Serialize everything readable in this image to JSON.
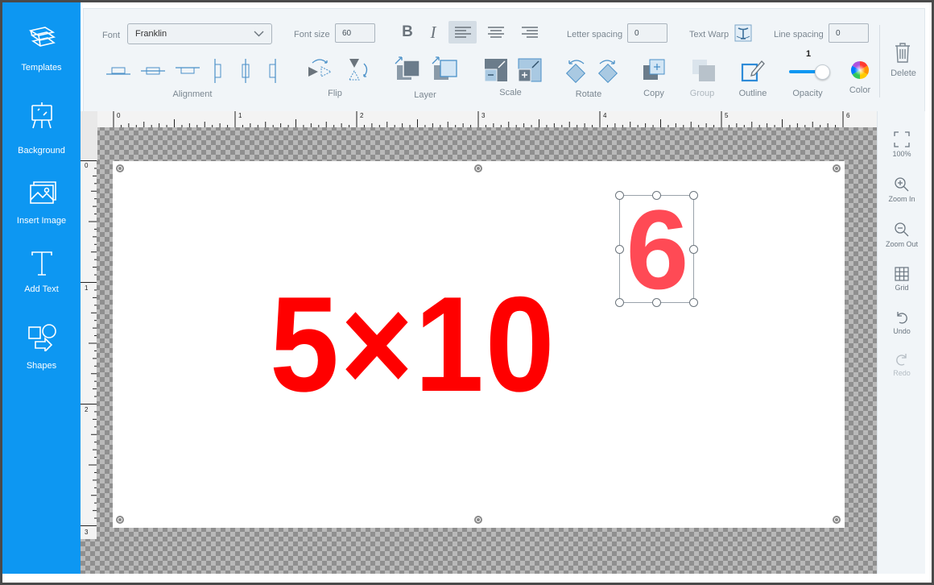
{
  "sidebar": {
    "items": [
      {
        "label": "Templates",
        "icon": "templates-icon"
      },
      {
        "label": "Background",
        "icon": "background-icon"
      },
      {
        "label": "Insert Image",
        "icon": "insert-image-icon"
      },
      {
        "label": "Add Text",
        "icon": "add-text-icon"
      },
      {
        "label": "Shapes",
        "icon": "shapes-icon"
      }
    ]
  },
  "toolbar": {
    "font_label": "Font",
    "font_value": "Franklin",
    "font_size_label": "Font size",
    "font_size_value": "60",
    "bold_label": "B",
    "italic_label": "I",
    "letter_spacing_label": "Letter spacing",
    "letter_spacing_value": "0",
    "text_warp_label": "Text Warp",
    "line_spacing_label": "Line spacing",
    "line_spacing_value": "0",
    "alignment_label": "Alignment",
    "flip_label": "Flip",
    "layer_label": "Layer",
    "scale_label": "Scale",
    "rotate_label": "Rotate",
    "copy_label": "Copy",
    "group_label": "Group",
    "outline_label": "Outline",
    "opacity_label": "Opacity",
    "opacity_value": "1",
    "color_label": "Color",
    "delete_label": "Delete",
    "accent_color": "#0d97f2"
  },
  "rulers": {
    "top_marks": [
      "0",
      "1",
      "2",
      "3",
      "4",
      "5",
      "6"
    ],
    "left_marks": [
      "0",
      "1",
      "2",
      "3"
    ]
  },
  "canvas": {
    "main_text": "5×10",
    "superscript_text": "6",
    "main_text_color": "#ff0000",
    "superscript_color": "#ff4a55"
  },
  "right_panel": {
    "items": [
      {
        "label": "100%",
        "icon": "fit-screen-icon",
        "enabled": true
      },
      {
        "label": "Zoom In",
        "icon": "zoom-in-icon",
        "enabled": true
      },
      {
        "label": "Zoom Out",
        "icon": "zoom-out-icon",
        "enabled": true
      },
      {
        "label": "Grid",
        "icon": "grid-icon",
        "enabled": true
      },
      {
        "label": "Undo",
        "icon": "undo-icon",
        "enabled": true
      },
      {
        "label": "Redo",
        "icon": "redo-icon",
        "enabled": false
      }
    ]
  }
}
